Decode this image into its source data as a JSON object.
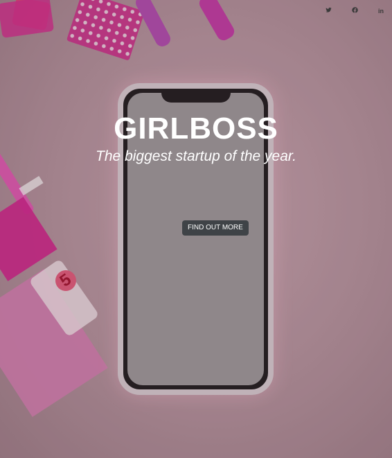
{
  "social": {
    "twitter_label": "",
    "facebook_label": "",
    "linkedin_label": "in"
  },
  "hero": {
    "title": "GIRLBOSS",
    "tagline": "The biggest startup of the year.",
    "cta_label": "FIND OUT MORE"
  },
  "decor": {
    "eraser_number": "5"
  },
  "colors": {
    "accent_pink": "#d52d8e",
    "button_bg": "#3f4347",
    "text_light": "#ffffff"
  }
}
